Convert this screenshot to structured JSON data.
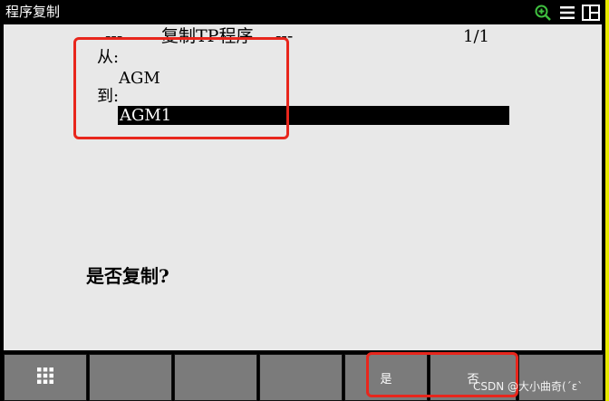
{
  "window": {
    "title": "程序复制",
    "icons": [
      "zoom-in-icon",
      "menu-icon",
      "split-view-icon"
    ]
  },
  "heading": {
    "left": "---",
    "title": "复制TP程序",
    "right": "---",
    "page_info": "1/1"
  },
  "form": {
    "from_label": "从:",
    "from_value": "AGM",
    "to_label": "到:",
    "to_value": "AGM1"
  },
  "prompt": "是否复制?",
  "function_keys": {
    "f1_icon": "grid-icon",
    "yes_label": "是",
    "no_label": "否"
  },
  "watermark": "CSDN @大小曲奇(´ε`",
  "colors": {
    "background": "#e8e8e8",
    "bar": "#000000",
    "key": "#7b7b7b",
    "annotation": "#e8261c",
    "input_highlight": "#000000"
  }
}
